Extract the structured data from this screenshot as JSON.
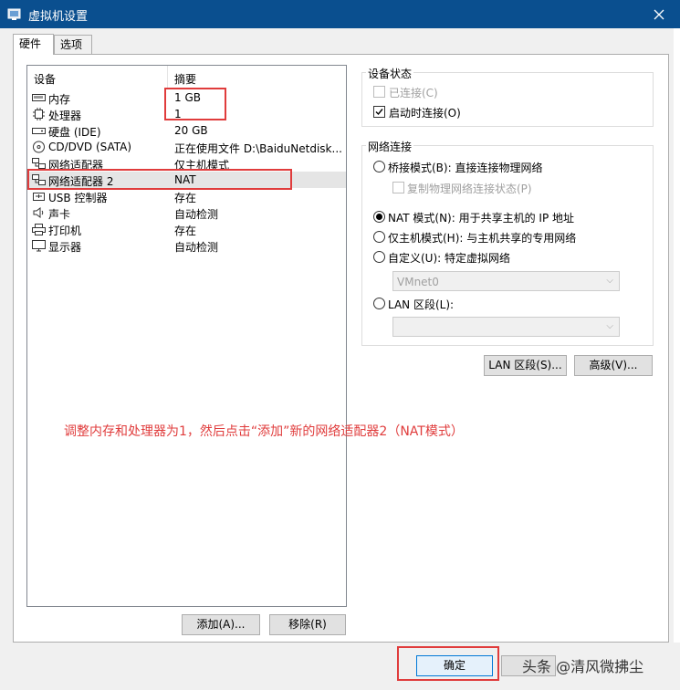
{
  "window": {
    "title": "虚拟机设置"
  },
  "tabs": [
    {
      "label": "硬件",
      "active": true
    },
    {
      "label": "选项",
      "active": false
    }
  ],
  "device_list": {
    "headers": {
      "device": "设备",
      "summary": "摘要"
    },
    "rows": [
      {
        "icon": "memory-icon",
        "name": "内存",
        "summary": "1 GB"
      },
      {
        "icon": "processor-icon",
        "name": "处理器",
        "summary": "1"
      },
      {
        "icon": "hard-disk-icon",
        "name": "硬盘 (IDE)",
        "summary": "20 GB"
      },
      {
        "icon": "cd-dvd-icon",
        "name": "CD/DVD (SATA)",
        "summary": "正在使用文件 D:\\BaiduNetdisk..."
      },
      {
        "icon": "network-adapter-icon",
        "name": "网络适配器",
        "summary": "仅主机模式"
      },
      {
        "icon": "network-adapter-icon",
        "name": "网络适配器 2",
        "summary": "NAT",
        "selected": true
      },
      {
        "icon": "usb-icon",
        "name": "USB 控制器",
        "summary": "存在"
      },
      {
        "icon": "speaker-icon",
        "name": "声卡",
        "summary": "自动检测"
      },
      {
        "icon": "printer-icon",
        "name": "打印机",
        "summary": "存在"
      },
      {
        "icon": "monitor-icon",
        "name": "显示器",
        "summary": "自动检测"
      }
    ],
    "add_button": "添加(A)...",
    "remove_button": "移除(R)"
  },
  "device_status": {
    "title": "设备状态",
    "connected": {
      "label": "已连接(C)",
      "checked": false,
      "enabled": false
    },
    "connect_at_power_on": {
      "label": "启动时连接(O)",
      "checked": true,
      "enabled": true
    }
  },
  "network_connection": {
    "title": "网络连接",
    "bridged": {
      "label": "桥接模式(B): 直接连接物理网络",
      "selected": false
    },
    "replicate": {
      "label": "复制物理网络连接状态(P)",
      "checked": false,
      "enabled": false
    },
    "nat": {
      "label": "NAT 模式(N): 用于共享主机的 IP 地址",
      "selected": true
    },
    "host_only": {
      "label": "仅主机模式(H): 与主机共享的专用网络",
      "selected": false
    },
    "custom": {
      "label": "自定义(U): 特定虚拟网络",
      "selected": false
    },
    "custom_value": "VMnet0",
    "lan_segment": {
      "label": "LAN 区段(L):",
      "selected": false
    },
    "lan_value": ""
  },
  "buttons": {
    "lan_segments": "LAN 区段(S)...",
    "advanced": "高级(V)...",
    "ok": "确定"
  },
  "annotation": {
    "text": "调整内存和处理器为1，然后点击“添加”新的网络适配器2（NAT模式）",
    "color": "#e03c3c"
  },
  "watermark": "头条 @清风微拂尘",
  "colors": {
    "titlebar": "#0a4f8f",
    "annotation": "#e03c3c",
    "selected_row": "#e5e5e5"
  }
}
